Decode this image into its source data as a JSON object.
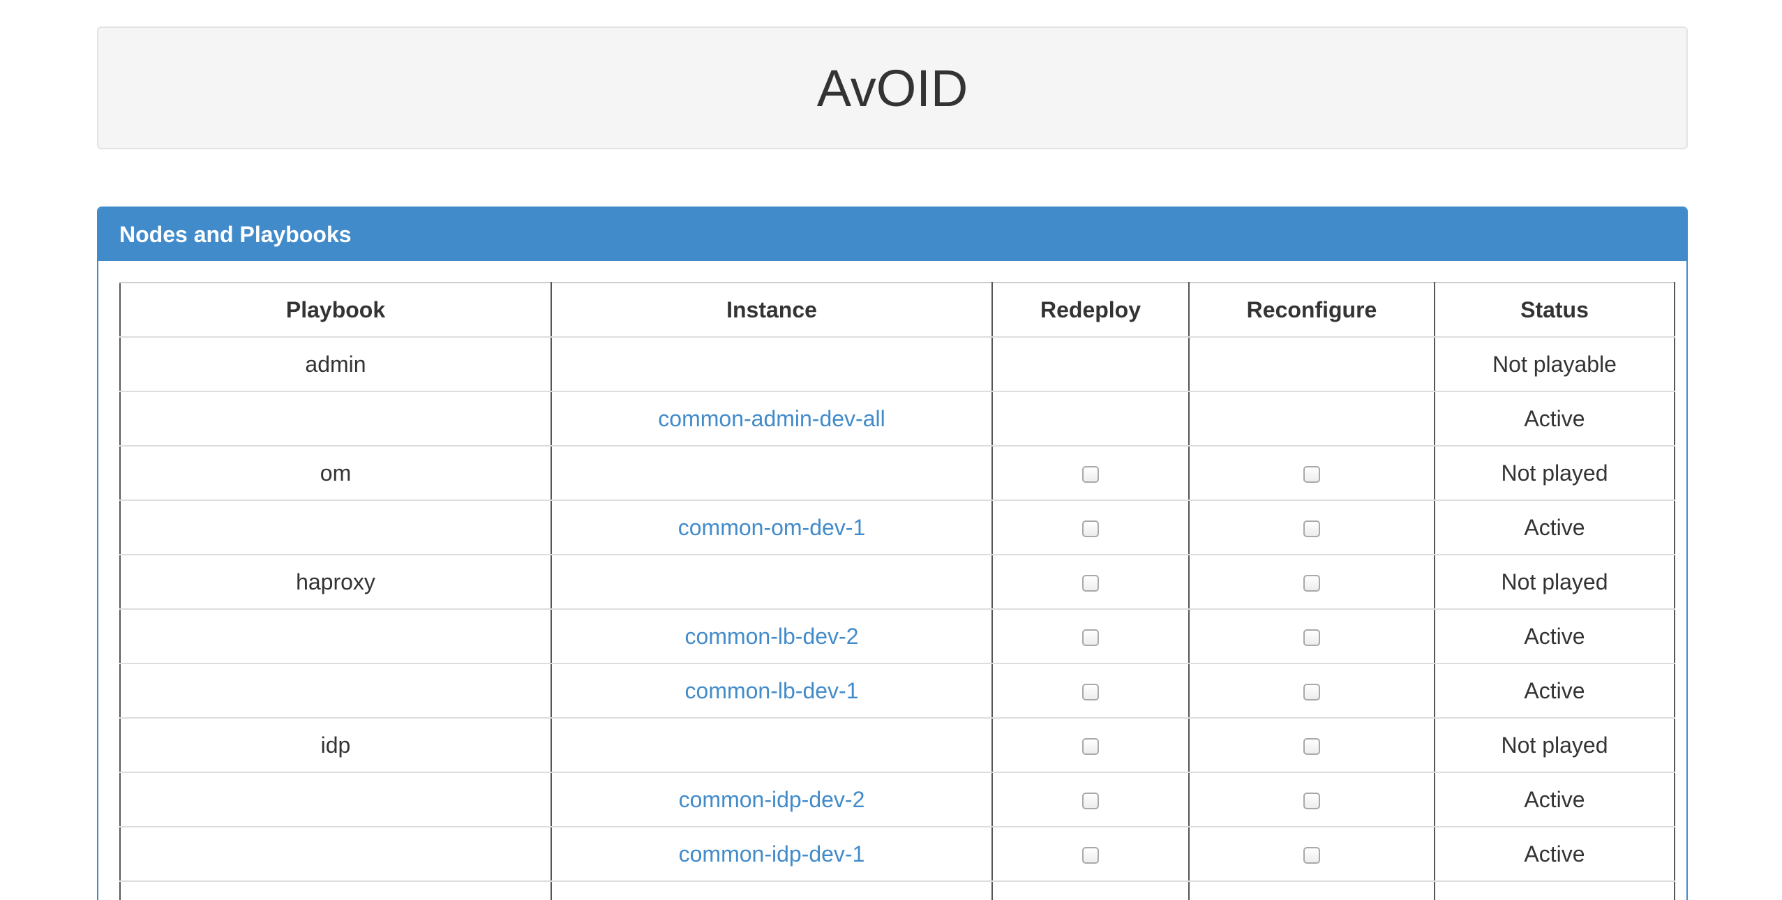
{
  "header": {
    "title": "AvOID"
  },
  "panel": {
    "title": "Nodes and Playbooks"
  },
  "table": {
    "columns": [
      "Playbook",
      "Instance",
      "Redeploy",
      "Reconfigure",
      "Status"
    ],
    "rows": [
      {
        "playbook": "admin",
        "instance": "",
        "redeploy": false,
        "reconfigure": false,
        "has_checkboxes": false,
        "status": "Not playable"
      },
      {
        "playbook": "",
        "instance": "common-admin-dev-all",
        "redeploy": false,
        "reconfigure": false,
        "has_checkboxes": false,
        "status": "Active"
      },
      {
        "playbook": "om",
        "instance": "",
        "redeploy": false,
        "reconfigure": false,
        "has_checkboxes": true,
        "status": "Not played"
      },
      {
        "playbook": "",
        "instance": "common-om-dev-1",
        "redeploy": false,
        "reconfigure": false,
        "has_checkboxes": true,
        "status": "Active"
      },
      {
        "playbook": "haproxy",
        "instance": "",
        "redeploy": false,
        "reconfigure": false,
        "has_checkboxes": true,
        "status": "Not played"
      },
      {
        "playbook": "",
        "instance": "common-lb-dev-2",
        "redeploy": false,
        "reconfigure": false,
        "has_checkboxes": true,
        "status": "Active"
      },
      {
        "playbook": "",
        "instance": "common-lb-dev-1",
        "redeploy": false,
        "reconfigure": false,
        "has_checkboxes": true,
        "status": "Active"
      },
      {
        "playbook": "idp",
        "instance": "",
        "redeploy": false,
        "reconfigure": false,
        "has_checkboxes": true,
        "status": "Not played"
      },
      {
        "playbook": "",
        "instance": "common-idp-dev-2",
        "redeploy": false,
        "reconfigure": false,
        "has_checkboxes": true,
        "status": "Active"
      },
      {
        "playbook": "",
        "instance": "common-idp-dev-1",
        "redeploy": false,
        "reconfigure": false,
        "has_checkboxes": true,
        "status": "Active"
      },
      {
        "playbook": "",
        "instance": "",
        "redeploy": false,
        "reconfigure": false,
        "has_checkboxes": true,
        "status": ""
      }
    ]
  },
  "colors": {
    "primary": "#428bca",
    "jumbotron_bg": "#f5f5f5",
    "text": "#333333"
  }
}
